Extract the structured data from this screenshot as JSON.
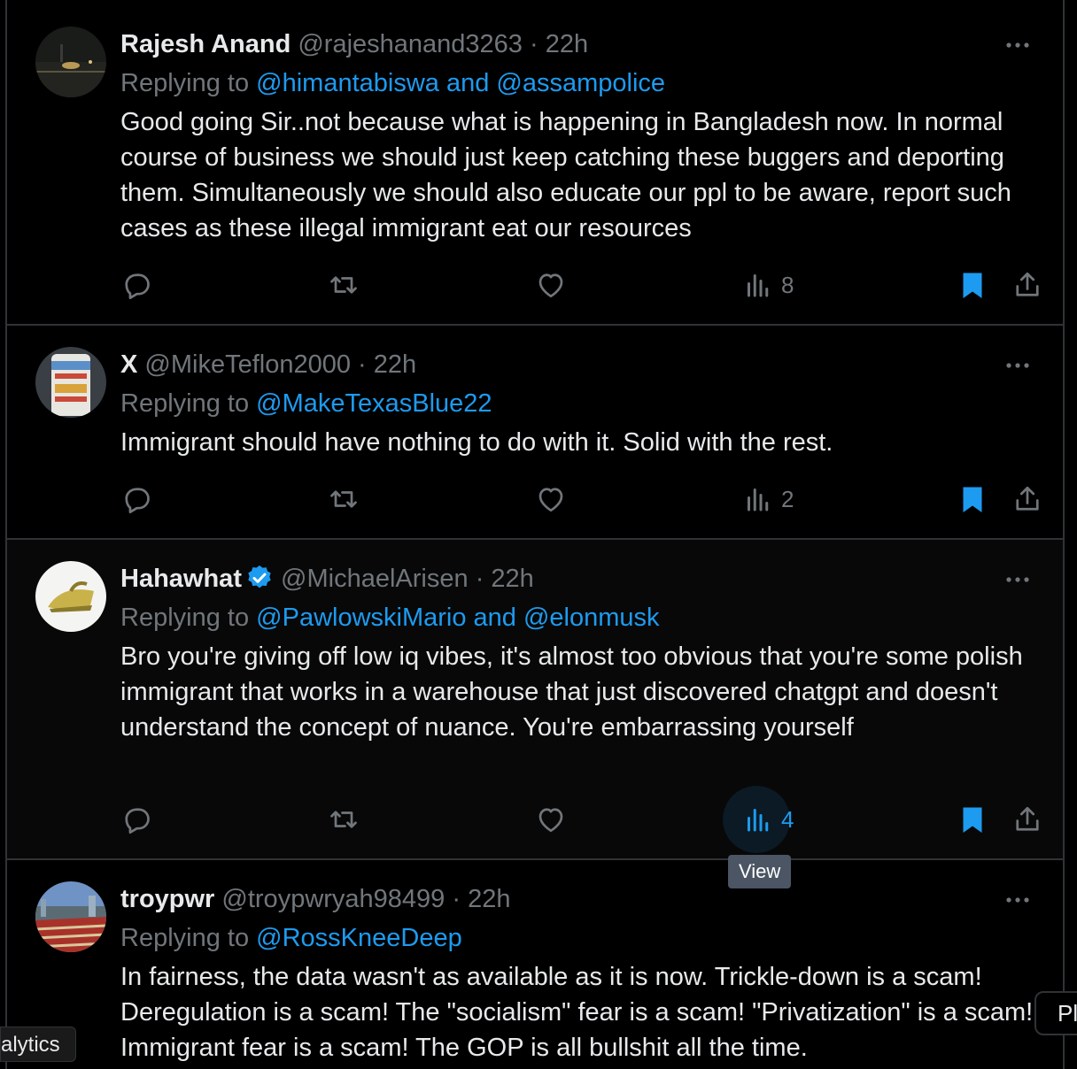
{
  "tweets": [
    {
      "name": "Rajesh Anand",
      "handle": "@rajeshanand3263",
      "dot": "·",
      "time": "22h",
      "replying_prefix": "Replying to",
      "replying_targets": "@himantabiswa and @assampolice",
      "text": "Good going Sir..not because what is happening in Bangladesh now. In normal course of business we should just keep catching  these buggers and deporting them. Simultaneously we should also educate our ppl to be aware, report such cases as these illegal immigrant eat our resources",
      "views": "8",
      "verified": false
    },
    {
      "name": "X",
      "handle": "@MikeTeflon2000",
      "dot": "·",
      "time": "22h",
      "replying_prefix": "Replying to",
      "replying_targets": "@MakeTexasBlue22",
      "text": "Immigrant should have nothing to do with it. Solid with the rest.",
      "views": "2",
      "verified": false
    },
    {
      "name": "Hahawhat",
      "handle": "@MichaelArisen",
      "dot": "·",
      "time": "22h",
      "replying_prefix": "Replying to",
      "replying_targets": "@PawlowskiMario and @elonmusk",
      "text": "Bro you're giving off low iq vibes, it's almost too obvious that you're some polish immigrant that works in a warehouse that just discovered chatgpt and doesn't understand the concept of nuance. You're embarrassing yourself",
      "views": "4",
      "verified": true
    },
    {
      "name": "troypwr",
      "handle": "@troypwryah98499",
      "dot": "·",
      "time": "22h",
      "replying_prefix": "Replying to",
      "replying_targets": "@RossKneeDeep",
      "text": "In fairness, the data wasn't as available as it is now. Trickle-down is a scam! Deregulation is a scam! The \"socialism\" fear is a scam! \"Privatization\" is a scam!! Immigrant fear is a scam! The GOP is all bullshit all the time.",
      "views": "",
      "verified": false
    }
  ],
  "tooltip": "View",
  "side_left_label": "alytics",
  "side_right_label": "Pl",
  "colors": {
    "link": "#1d9bf0",
    "muted": "#71767b",
    "bookmark": "#1d9bf0",
    "verified": "#1d9bf0"
  }
}
